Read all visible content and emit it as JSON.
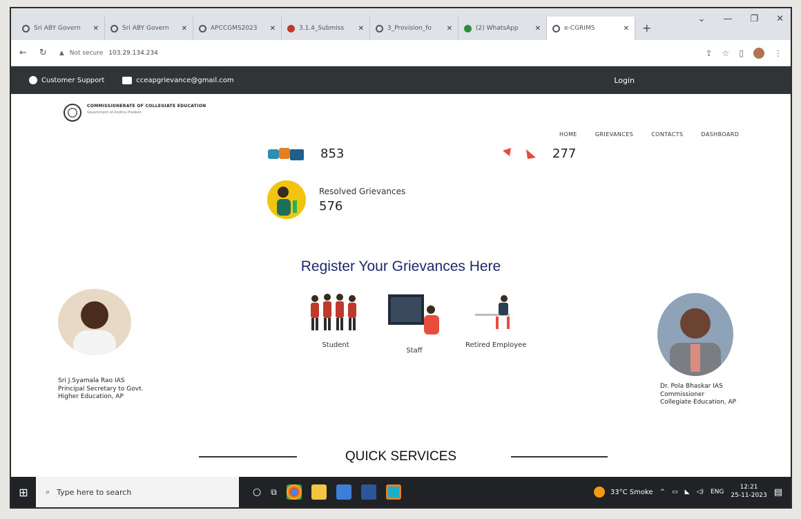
{
  "browser": {
    "tabs": [
      {
        "title": "Sri ABY Govern",
        "icon": "globe-icon"
      },
      {
        "title": "Sri ABY Govern",
        "icon": "globe-icon"
      },
      {
        "title": "APCCGMS2023",
        "icon": "globe-icon"
      },
      {
        "title": "3.1.4_Submiss",
        "icon": "pdf-icon"
      },
      {
        "title": "3_Provision_fo",
        "icon": "globe-icon"
      },
      {
        "title": "(2) WhatsApp",
        "icon": "whatsapp-icon"
      },
      {
        "title": "e-CGRIMS",
        "icon": "globe-icon"
      }
    ],
    "new_tab": "+",
    "security_label": "Not secure",
    "url": "103.29.134.234"
  },
  "topbar": {
    "support": "Customer Support",
    "email": "cceapgrievance@gmail.com",
    "login": "Login"
  },
  "header": {
    "org_title": "COMMISSIONERATE OF COLLEGIATE EDUCATION",
    "org_subtitle": "Government of Andhra Pradesh",
    "nav": [
      "HOME",
      "GRIEVANCES",
      "CONTACTS",
      "DASHBOARD"
    ]
  },
  "stats": {
    "first_value": "853",
    "second_value": "277",
    "resolved_label": "Resolved Grievances",
    "resolved_value": "576"
  },
  "register": {
    "title": "Register Your Grievances Here",
    "roles": [
      "Student",
      "Staff",
      "Retired Employee"
    ]
  },
  "people": {
    "left_caption": "Sri J.Syamala Rao IAS\nPrincipal Secretary to Govt.\nHigher Education, AP",
    "right_caption": "Dr. Pola Bhaskar IAS\nCommissioner\nCollegiate Education, AP"
  },
  "quick_services": "QUICK SERVICES",
  "taskbar": {
    "search_placeholder": "Type here to search",
    "weather": "33°C Smoke",
    "lang": "ENG",
    "time": "12:21",
    "date": "25-11-2023"
  },
  "colors": {
    "topbar": "#2f3436",
    "title_blue": "#1c2a6b",
    "taskbar": "#202226"
  }
}
